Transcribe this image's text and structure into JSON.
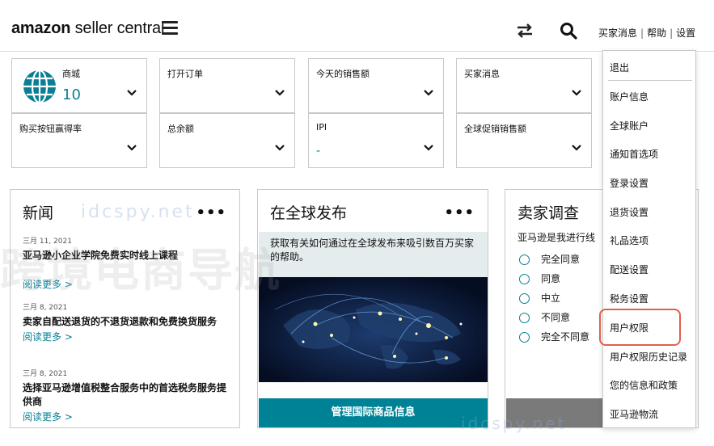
{
  "header": {
    "logo_bold": "amazon",
    "logo_rest": " seller central",
    "links": [
      "买家消息",
      "帮助",
      "设置"
    ]
  },
  "widgets": [
    {
      "label": "商城",
      "value": "10"
    },
    {
      "label": "打开订单",
      "value": ""
    },
    {
      "label": "今天的销售额",
      "value": ""
    },
    {
      "label": "买家消息",
      "value": ""
    },
    {
      "label": "购买按钮赢得率",
      "value": ""
    },
    {
      "label": "总余额",
      "value": ""
    },
    {
      "label": "IPI",
      "value": "-"
    },
    {
      "label": "全球促销销售额",
      "value": ""
    }
  ],
  "news": {
    "title": "新闻",
    "more_icon": "•••",
    "items": [
      {
        "date": "三月 11, 2021",
        "headline": "亚马逊小企业学院免费实时线上课程",
        "more": "阅读更多 >"
      },
      {
        "date": "三月 8, 2021",
        "headline": "卖家自配送退货的不退货退款和免费换货服务",
        "more": "阅读更多 >"
      },
      {
        "date": "三月 8, 2021",
        "headline": "选择亚马逊增值税整合服务中的首选税务服务提供商",
        "more": "阅读更多 >"
      }
    ]
  },
  "global": {
    "title": "在全球发布",
    "more_icon": "•••",
    "description": "获取有关如何通过在全球发布来吸引数百万买家的帮助。",
    "button": "管理国际商品信息"
  },
  "survey": {
    "title": "卖家调查",
    "question": "亚马逊是我进行线",
    "options": [
      "完全同意",
      "同意",
      "中立",
      "不同意",
      "完全不同意"
    ]
  },
  "menu": {
    "items": [
      "退出",
      "账户信息",
      "全球账户",
      "通知首选项",
      "登录设置",
      "退货设置",
      "礼品选项",
      "配送设置",
      "税务设置",
      "用户权限",
      "用户权限历史记录",
      "您的信息和政策",
      "亚马逊物流"
    ]
  },
  "colors": {
    "accent": "#0a7f93",
    "button_teal": "#008296",
    "highlight": "#e0604a"
  },
  "watermark": {
    "text1": "idcspy.net",
    "text2": "跨境电商导航",
    "text3": "idcspy.net"
  }
}
